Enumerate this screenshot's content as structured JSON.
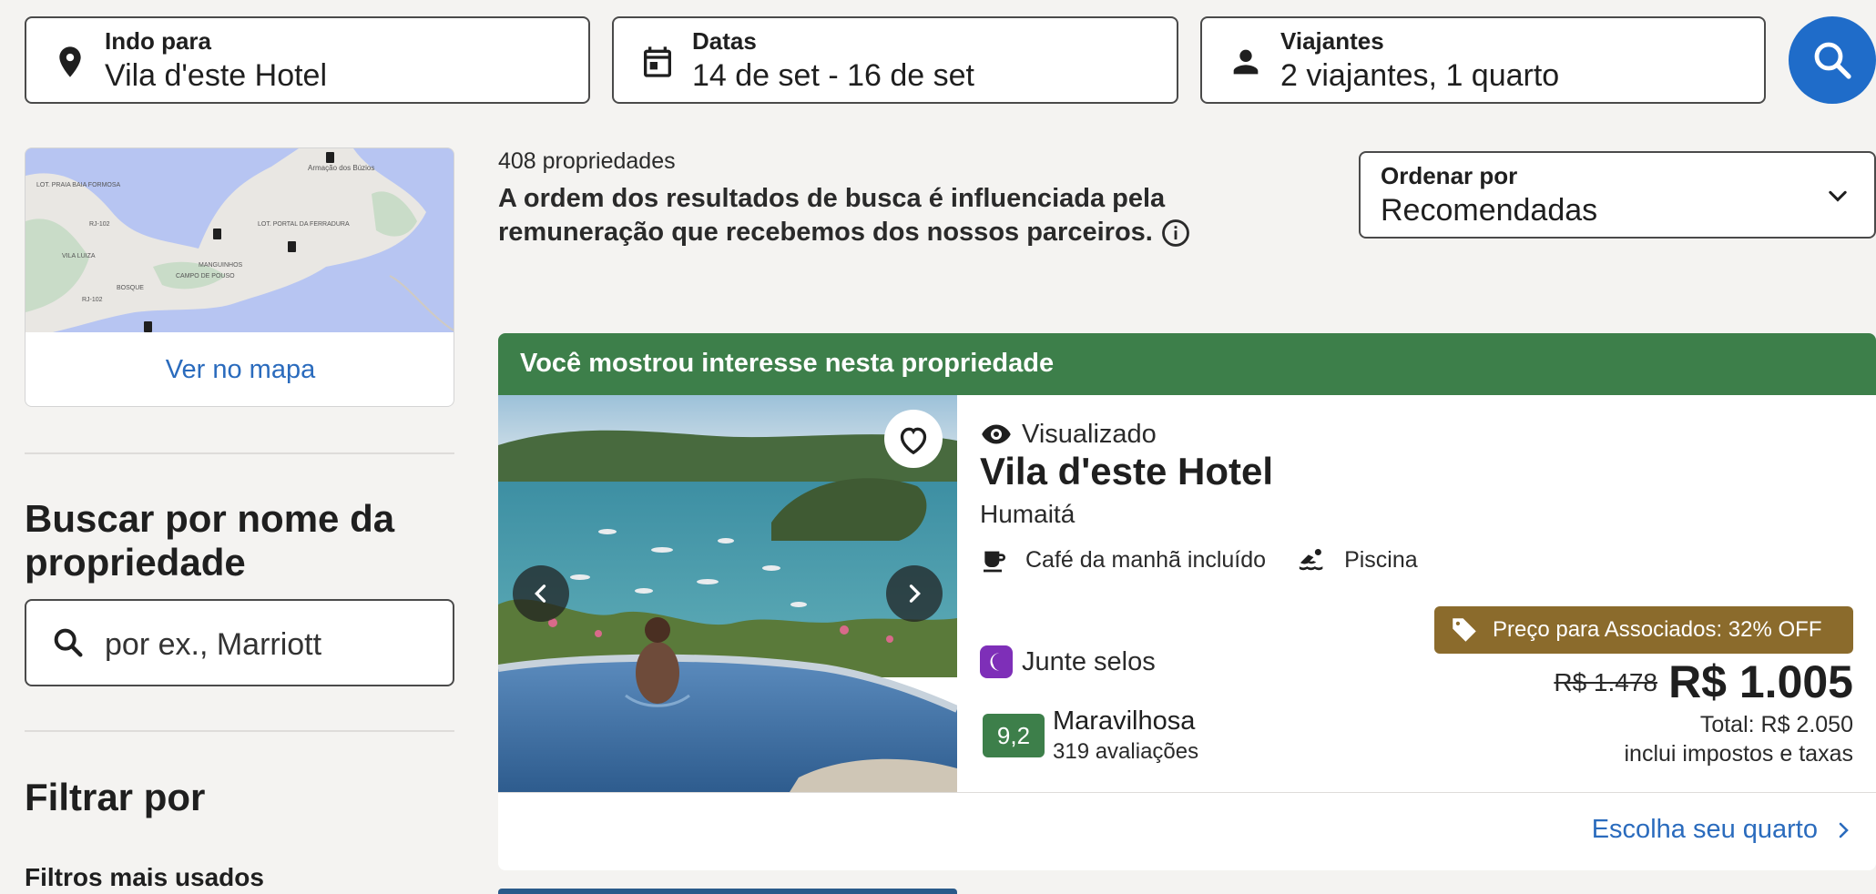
{
  "search": {
    "destination": {
      "label": "Indo para",
      "value": "Vila d'este Hotel",
      "icon": "map-pin-icon"
    },
    "dates": {
      "label": "Datas",
      "value": "14 de set - 16 de set",
      "icon": "calendar-icon"
    },
    "travelers": {
      "label": "Viajantes",
      "value": "2 viajantes, 1 quarto",
      "icon": "person-icon"
    },
    "submit_icon": "search-icon",
    "accent_color": "#1f6cc9"
  },
  "sidebar": {
    "map": {
      "link_label": "Ver no mapa",
      "place_labels": [
        "LOT. PRAIA BAIA FORMOSA",
        "RJ-102",
        "VILA LUIZA",
        "Armação dos Búzios",
        "LOT. PORTAL DA FERRADURA",
        "MANGUINHOS",
        "CAMPO DE POUSO",
        "BOSQUE",
        "RJ-102"
      ]
    },
    "property_search": {
      "heading": "Buscar por nome da propriedade",
      "placeholder": "por ex., Marriott"
    },
    "filter": {
      "heading": "Filtrar por",
      "subheading": "Filtros mais usados"
    }
  },
  "results": {
    "count": "408 propriedades",
    "disclaimer": "A ordem dos resultados de busca é influenciada pela remuneração que recebemos dos nossos parceiros.",
    "sort": {
      "label": "Ordenar por",
      "value": "Recomendadas"
    }
  },
  "listing": {
    "banner": "Você mostrou interesse nesta propriedade",
    "banner_color": "#3d7f4a",
    "viewed_label": "Visualizado",
    "name": "Vila d'este Hotel",
    "location": "Humaitá",
    "amenities": [
      {
        "label": "Café da manhã incluído",
        "icon": "coffee-icon"
      },
      {
        "label": "Piscina",
        "icon": "pool-icon"
      }
    ],
    "loyalty_label": "Junte selos",
    "rating": {
      "score": "9,2",
      "word": "Maravilhosa",
      "reviews": "319 avaliações"
    },
    "member_tag": "Preço para Associados: 32% OFF",
    "old_price": "R$ 1.478",
    "price": "R$ 1.005",
    "total": "Total: R$ 2.050",
    "taxes": "inclui impostos e taxas",
    "cta": "Escolha seu quarto"
  }
}
